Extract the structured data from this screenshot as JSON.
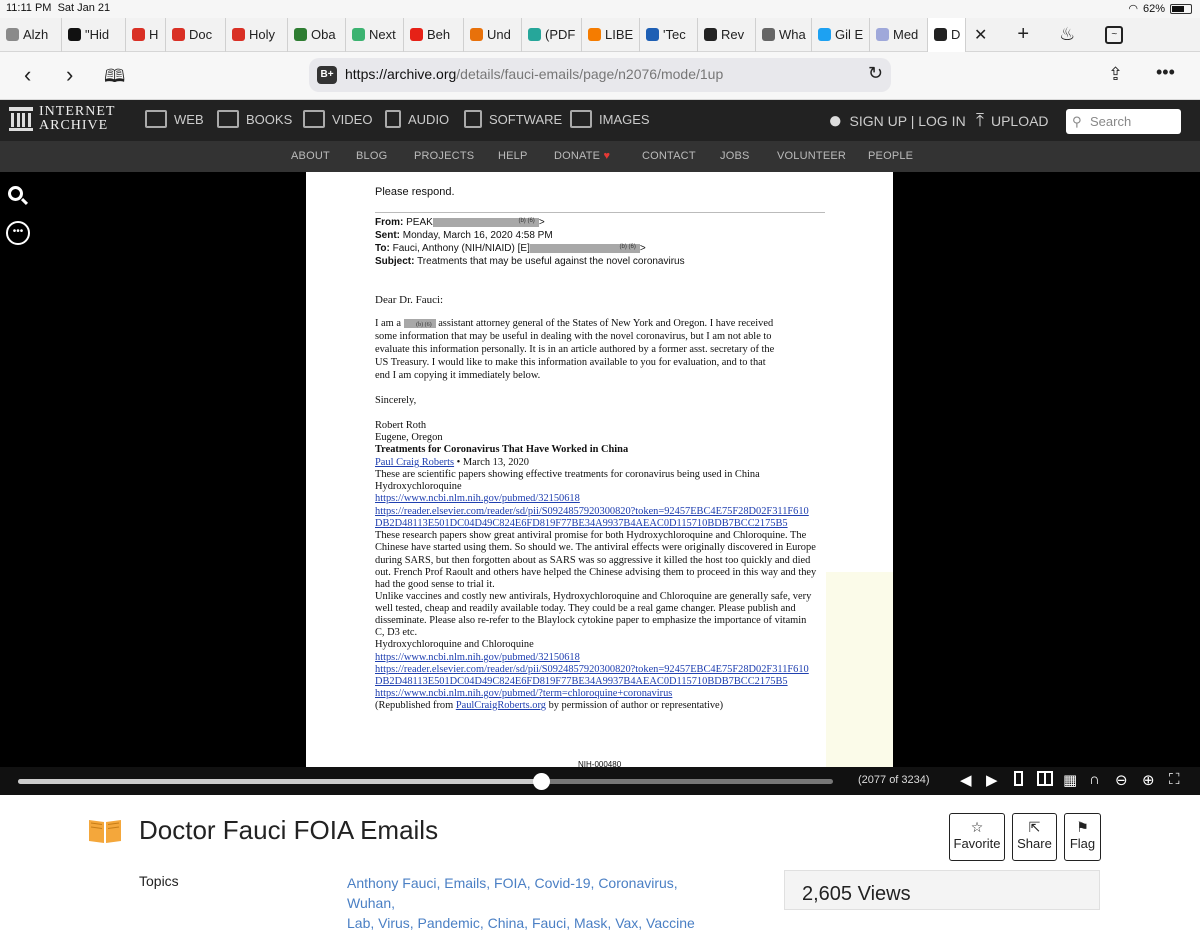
{
  "status": {
    "time": "11:11 PM",
    "date": "Sat Jan 21",
    "battery": "62%"
  },
  "tabs": [
    {
      "label": "Alzh",
      "color": "#8a8a8a"
    },
    {
      "label": "\"Hid",
      "color": "#111111"
    },
    {
      "label": "H",
      "color": "#d93025"
    },
    {
      "label": "Doc",
      "color": "#d93025"
    },
    {
      "label": "Holy",
      "color": "#d93025"
    },
    {
      "label": "Oba",
      "color": "#2e7d32"
    },
    {
      "label": "Next",
      "color": "#3cb371"
    },
    {
      "label": "Beh",
      "color": "#e62117"
    },
    {
      "label": "Und",
      "color": "#e8710a"
    },
    {
      "label": "(PDF",
      "color": "#26a69a"
    },
    {
      "label": "LIBE",
      "color": "#f57c00"
    },
    {
      "label": "'Tec",
      "color": "#1e5fb4"
    },
    {
      "label": "Rev",
      "color": "#222222"
    },
    {
      "label": "Wha",
      "color": "#666666"
    },
    {
      "label": "Gil E",
      "color": "#1da1f2"
    },
    {
      "label": "Med",
      "color": "#9fa8da"
    },
    {
      "label": "D",
      "color": "#222222"
    }
  ],
  "address": {
    "prefix": "https://archive.org",
    "rest": "/details/fauci-emails/page/n2076/mode/1up"
  },
  "ia": {
    "logo_line1": "INTERNET",
    "logo_line2": "ARCHIVE",
    "menu": {
      "web": "WEB",
      "books": "BOOKS",
      "video": "VIDEO",
      "audio": "AUDIO",
      "software": "SOFTWARE",
      "images": "IMAGES"
    },
    "signup": "SIGN UP | LOG IN",
    "upload": "UPLOAD",
    "search_placeholder": "Search",
    "subnav": {
      "about": "ABOUT",
      "blog": "BLOG",
      "projects": "PROJECTS",
      "help": "HELP",
      "donate": "DONATE",
      "contact": "CONTACT",
      "jobs": "JOBS",
      "volunteer": "VOLUNTEER",
      "people": "PEOPLE"
    }
  },
  "doc": {
    "please": "Please respond.",
    "from_label": "From:",
    "from_val": "PEAK",
    "redact_tag": "(b) (6)",
    "sent_label": "Sent:",
    "sent_val": "Monday, March 16, 2020 4:58 PM",
    "to_label": "To:",
    "to_val": "Fauci, Anthony (NIH/NIAID) [E]",
    "subject_label": "Subject:",
    "subject_val": "Treatments that may be useful against the novel coronavirus",
    "salutation": "Dear Dr. Fauci:",
    "p1_a": "I am a",
    "p1_b": "assistant attorney general of the States of New York and Oregon.  I have received",
    "p1_l2": "some information that may be useful in dealing with the novel coronavirus, but I am not able to",
    "p1_l3": "evaluate this information personally.  It is in an article authored by a former asst. secretary of the",
    "p1_l4": "US Treasury.  I would like to make this information available to you for evaluation, and to that",
    "p1_l5": "end I am copying it immediately below.",
    "sincerely": "Sincerely,",
    "name": "Robert Roth",
    "city": "Eugene, Oregon",
    "article_title": "Treatments for Coronavirus That Have Worked in China",
    "author": "Paul Craig Roberts",
    "article_date": " • March 13, 2020",
    "l_scientific": "These are scientific papers showing effective treatments for coronavirus being used in China",
    "l_hcq": "Hydroxychloroquine",
    "link1": "https://www.ncbi.nlm.nih.gov/pubmed/32150618",
    "link2a": "https://reader.elsevier.com/reader/sd/pii/S0924857920300820?token=92457EBC4E75F28D02F311F610",
    "link2b": "DB2D48113E501DC04D49C824E6FD819F77BE34A9937B4AEAC0D115710BDB7BCC2175B5",
    "r1": "These research papers show great antiviral promise for both Hydroxychloroquine and Chloroquine. The",
    "r2": "Chinese have started using them. So should we. The antiviral effects were originally discovered in Europe",
    "r3": "during SARS, but then forgotten about as SARS was so aggressive it killed the host too quickly and died",
    "r4": "out. French Prof Raoult and others have helped the Chinese advising them to proceed in this way and they",
    "r5": "had the good sense to trial it.",
    "u1": "Unlike vaccines and costly new antivirals, Hydroxychloroquine and Chloroquine are generally safe, very",
    "u2": "well tested, cheap and readily available today. They could be a real game changer. Please publish and",
    "u3": "disseminate. Please also re-refer to the Blaylock cytokine paper to emphasize the importance of vitamin",
    "u4": "C, D3 etc.",
    "hc2": "Hydroxychloroquine and Chloroquine",
    "link3": "https://www.ncbi.nlm.nih.gov/pubmed/32150618",
    "link4a": "https://reader.elsevier.com/reader/sd/pii/S0924857920300820?token=92457EBC4E75F28D02F311F610",
    "link4b": "DB2D48113E501DC04D49C824E6FD819F77BE34A9937B4AEAC0D115710BDB7BCC2175B5",
    "link5": "https://www.ncbi.nlm.nih.gov/pubmed/?term=chloroquine+coronavirus",
    "repub_a": "(Republished from ",
    "repub_link": "PaulCraigRoberts.org",
    "repub_b": " by permission of author or representative)",
    "footer_id": "NIH-000480"
  },
  "reader": {
    "page_label": "(2077 of 3234)",
    "current_page": 2077,
    "total_pages": 3234
  },
  "item": {
    "title": "Doctor Fauci FOIA Emails",
    "favorite": "Favorite",
    "share": "Share",
    "flag": "Flag",
    "topics_label": "Topics",
    "topics_line1": "Anthony Fauci, Emails, FOIA, Covid-19, Coronavirus, Wuhan,",
    "topics_line2": "Lab, Virus, Pandemic, China, Fauci, Mask, Vax, Vaccine",
    "views": "2,605 Views"
  }
}
